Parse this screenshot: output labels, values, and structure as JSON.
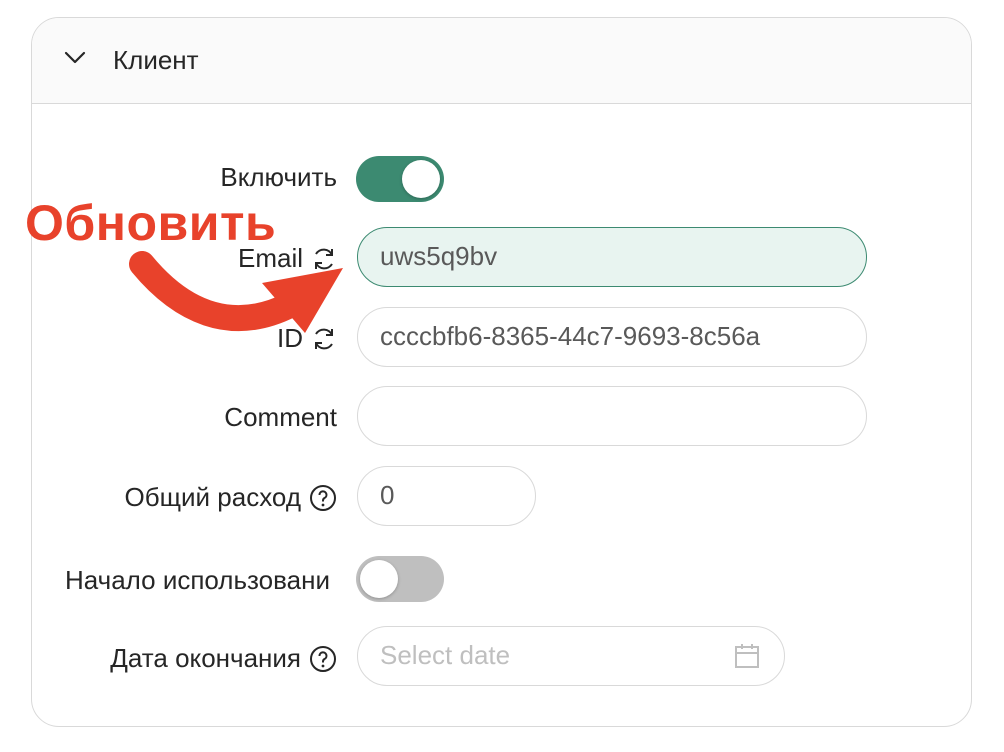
{
  "section": {
    "title": "Клиент",
    "collapse_icon": "chevron-down-icon"
  },
  "fields": {
    "enable": {
      "label": "Включить",
      "value": true
    },
    "email": {
      "label": "Email",
      "icon": "refresh-icon",
      "value": "uws5q9bv"
    },
    "id": {
      "label": "ID",
      "icon": "refresh-icon",
      "value": "ccccbfb6-8365-44c7-9693-8c56a"
    },
    "comment": {
      "label": "Comment",
      "value": ""
    },
    "total_spend": {
      "label": "Общий расход",
      "icon": "help-icon",
      "value": "0"
    },
    "start_use": {
      "label": "Начало использовани",
      "value": false
    },
    "end_date": {
      "label": "Дата окончания",
      "icon": "help-icon",
      "placeholder": "Select date",
      "suffix_icon": "calendar-icon"
    }
  },
  "annotation": {
    "text": "Обновить",
    "color": "#e8422b"
  },
  "colors": {
    "accent": "#3c8a71",
    "focused_bg": "#e8f4f0",
    "border": "#d9d9d9",
    "toggle_off": "#bfbfbf"
  }
}
